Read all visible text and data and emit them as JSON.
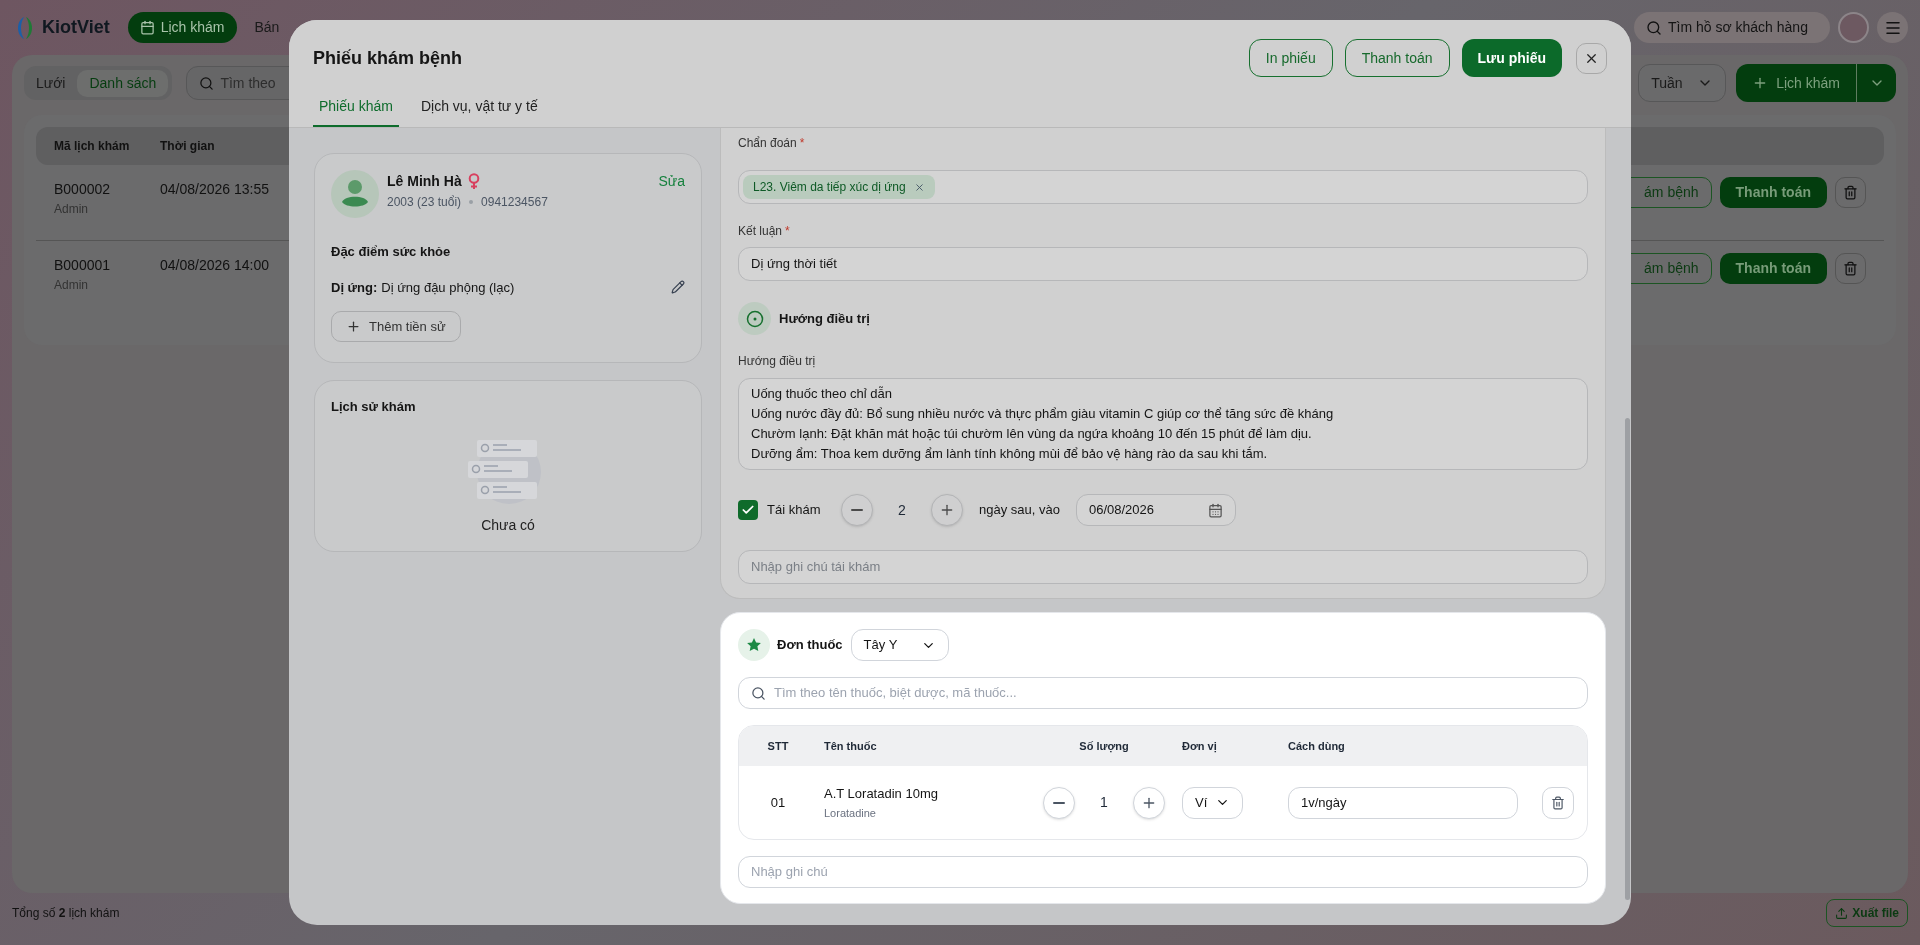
{
  "app": {
    "logo": "KiotViet",
    "nav": [
      {
        "label": "Lịch khám",
        "selected": true
      },
      {
        "label": "Bán",
        "selected": false
      }
    ],
    "customer_search": {
      "placeholder": "Tìm hồ sơ khách hàng"
    }
  },
  "toolbar": {
    "views": [
      {
        "label": "Lưới",
        "selected": false
      },
      {
        "label": "Danh sách",
        "selected": true
      }
    ],
    "search": {
      "placeholder": "Tìm theo"
    },
    "period": "Tuần",
    "add_button": "Lịch khám"
  },
  "table": {
    "columns": [
      "Mã lịch khám",
      "Thời gian"
    ],
    "rows": [
      {
        "code": "B000002",
        "creator": "Admin",
        "time": "04/08/2026 13:55",
        "exam_button": "ám bệnh",
        "pay_button": "Thanh toán"
      },
      {
        "code": "B000001",
        "creator": "Admin",
        "time": "04/08/2026 14:00",
        "exam_button": "ám bệnh",
        "pay_button": "Thanh toán"
      }
    ]
  },
  "footer": {
    "total": "Tổng số **2** lịch khám",
    "export": "Xuất file"
  },
  "dialog": {
    "title": "Phiếu khám bệnh",
    "actions": [
      {
        "label": "In phiếu",
        "kind": "outline"
      },
      {
        "label": "Thanh toán",
        "kind": "outline"
      },
      {
        "label": "Lưu phiếu",
        "kind": "primary"
      }
    ],
    "tabs": [
      {
        "label": "Phiếu khám",
        "selected": true
      },
      {
        "label": "Dịch vụ, vật tư y tế",
        "selected": false
      }
    ],
    "patient": {
      "name": "Lê Minh Hà",
      "birth": "2003 (23 tuổi)",
      "phone": "0941234567",
      "edit": "Sửa"
    },
    "health": {
      "title": "Đặc điểm sức khỏe",
      "items": [
        {
          "label": "Dị ứng:",
          "value": "Dị ứng đậu phộng (lạc)"
        }
      ],
      "add_button": "Thêm tiền sử"
    },
    "history": {
      "title": "Lịch sử khám",
      "empty": "Chưa có"
    },
    "exam": {
      "diagnosis": {
        "label": "Chẩn đoán",
        "mark": "*",
        "tags": [
          "L23. Viêm da tiếp xúc dị ứng"
        ]
      },
      "conclusion": {
        "label": "Kết luận",
        "mark": "*",
        "value": "Dị ứng thời tiết"
      },
      "treatment": {
        "section": "Hướng điều trị",
        "label": "Hướng điều trị",
        "value": "Uống thuốc theo chỉ dẫn\nUống nước đầy đủ: Bổ sung nhiều nước và thực phẩm giàu vitamin C giúp cơ thể tăng sức đề kháng\nChườm lạnh: Đặt khăn mát hoặc túi chườm lên vùng da ngứa khoảng 10 đến 15 phút để làm dịu.\nDưỡng ẩm: Thoa kem dưỡng ẩm lành tính không mùi để bảo vệ hàng rào da sau khi tắm."
      },
      "revisit": {
        "checked": true,
        "label": "Tái khám",
        "days": "2",
        "after": "ngày sau, vào",
        "date": "06/08/2026",
        "note_placeholder": "Nhập ghi chú tái khám"
      }
    },
    "prescription": {
      "title": "Đơn thuốc",
      "type": "Tây Y",
      "search_placeholder": "Tìm theo tên thuốc, biệt dược, mã thuốc...",
      "columns": [
        "STT",
        "Tên thuốc",
        "Số lượng",
        "Đơn vị",
        "Cách dùng"
      ],
      "rows": [
        {
          "index": "01",
          "name": "A.T Loratadin 10mg",
          "generic": "Loratadine",
          "quantity": "1",
          "unit": "Ví",
          "usage": "1v/ngày"
        }
      ],
      "note_placeholder": "Nhập ghi chú"
    }
  }
}
